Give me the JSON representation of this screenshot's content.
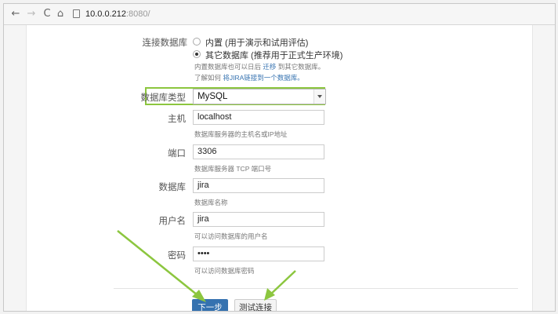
{
  "browser": {
    "back": "←",
    "forward": "→",
    "reload": "C",
    "home": "⌂",
    "host": "10.0.0.212",
    "port": ":8080/"
  },
  "form": {
    "db_connection": {
      "label": "连接数据库",
      "option_builtin": "内置 (用于演示和试用评估)",
      "option_other": "其它数据库 (推荐用于正式生产环境)",
      "selected": "其它数据库 (推荐用于正式生产环境)",
      "hint1_prefix": "内置数据库也可以日后",
      "hint1_link": "迁移",
      "hint1_suffix": "到其它数据库。",
      "hint2_prefix": "了解如何",
      "hint2_link": "将JIRA链接到一个数据库。"
    },
    "db_type": {
      "label": "数据库类型",
      "value": "MySQL"
    },
    "host": {
      "label": "主机",
      "value": "localhost",
      "hint": "数据库服务器的主机名或IP地址"
    },
    "port": {
      "label": "端口",
      "value": "3306",
      "hint": "数据库服务器 TCP 端口号"
    },
    "database": {
      "label": "数据库",
      "value": "jira",
      "hint": "数据库名称"
    },
    "username": {
      "label": "用户名",
      "value": "jira",
      "hint": "可以访问数据库的用户名"
    },
    "password": {
      "label": "密码",
      "value": "••••",
      "hint": "可以访问数据库密码"
    }
  },
  "buttons": {
    "next": "下一步",
    "test": "测试连接"
  },
  "colors": {
    "accent_highlight": "#8cc63f",
    "primary_button": "#3572b0"
  }
}
